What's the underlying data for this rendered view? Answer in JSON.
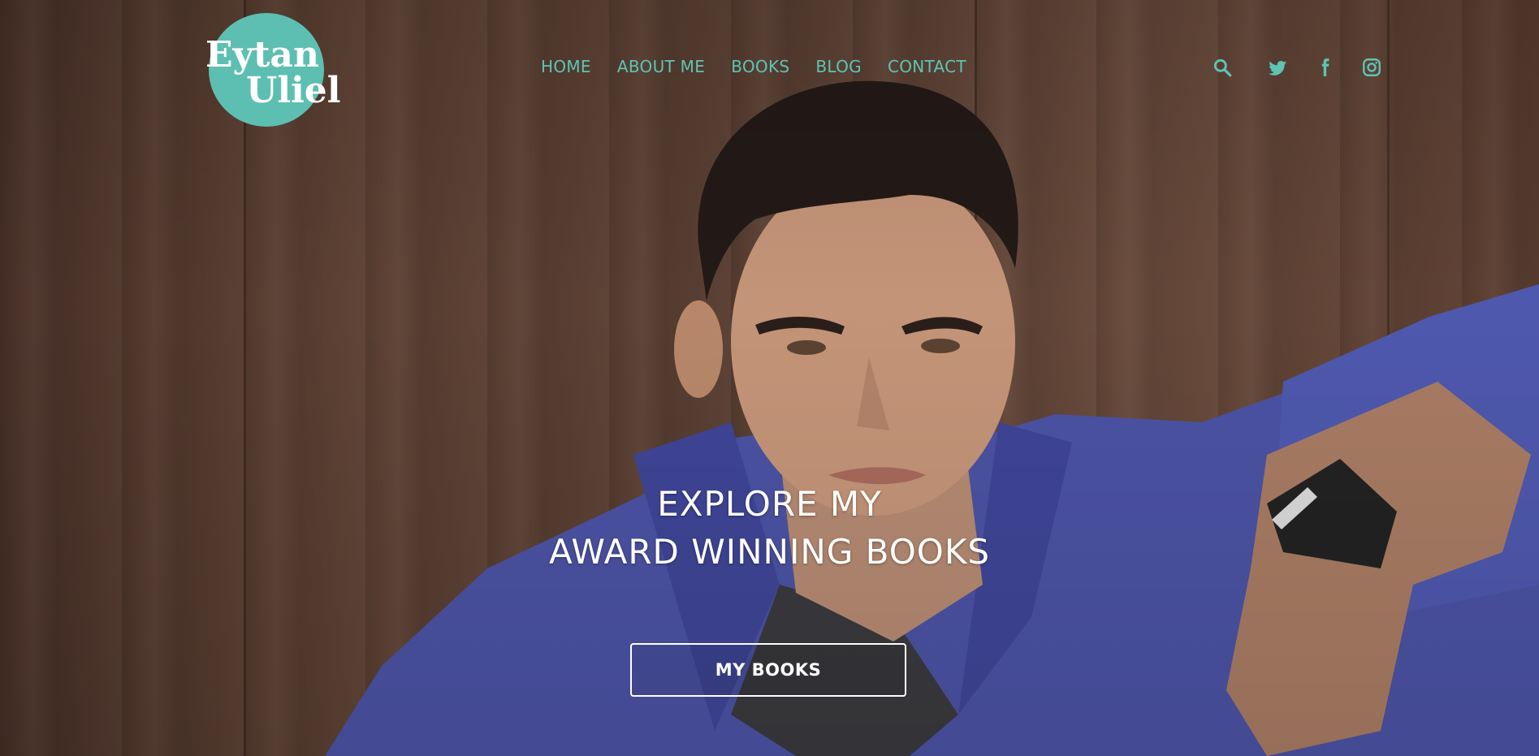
{
  "logo": {
    "line1": "Eytan",
    "line2": "Uliel",
    "color": "#5dbfb1"
  },
  "nav": {
    "items": [
      {
        "label": "HOME"
      },
      {
        "label": "ABOUT ME"
      },
      {
        "label": "BOOKS"
      },
      {
        "label": "BLOG"
      },
      {
        "label": "CONTACT"
      }
    ],
    "color": "#5ec4b4"
  },
  "header_icons": [
    "search-icon",
    "twitter-icon",
    "facebook-icon",
    "instagram-icon"
  ],
  "hero": {
    "headline_line1": "EXPLORE MY",
    "headline_line2": "AWARD WINNING BOOKS",
    "cta_label": "MY BOOKS"
  }
}
